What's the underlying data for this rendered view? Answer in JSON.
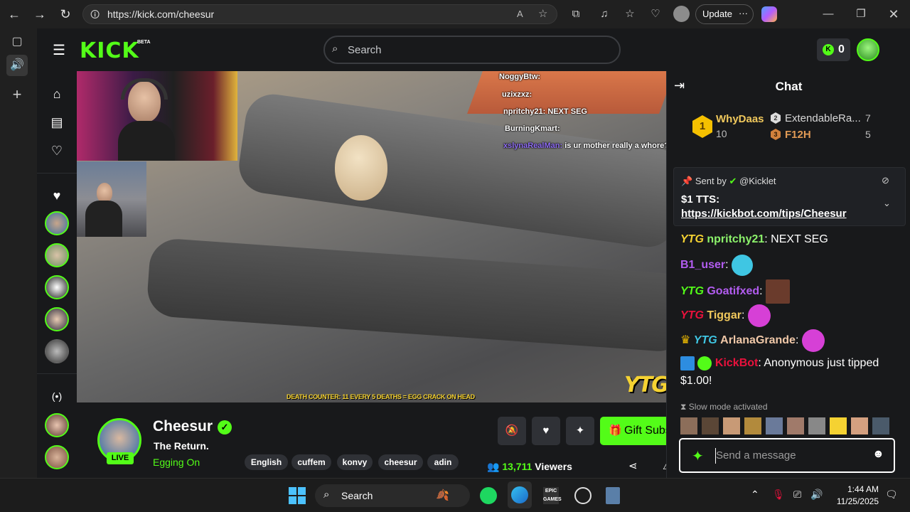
{
  "browser": {
    "url": "https://kick.com/cheesur",
    "update_label": "Update",
    "more_glyph": "···"
  },
  "site": {
    "logo": "KICK",
    "logo_badge": "BETA",
    "search_placeholder": "Search",
    "kicks_balance": "0",
    "accent_color": "#53fc18"
  },
  "stream": {
    "streamer_name": "Cheesur",
    "live_label": "LIVE",
    "title": "The Return.",
    "category": "Egging On",
    "tags": [
      "English",
      "cuffem",
      "konvy",
      "cheesur",
      "adin"
    ],
    "gift_subs_label": "Gift Subs",
    "viewer_count": "13,711",
    "viewers_label": "Viewers",
    "video_overlay": {
      "chat_lines": [
        {
          "name": "NoggyBtw:",
          "msg": ""
        },
        {
          "name": "uzixzxz:",
          "msg": ""
        },
        {
          "name": "npritchy21:",
          "msg": "NEXT SEG"
        },
        {
          "name": "BurningKmart:",
          "msg": ""
        },
        {
          "name": "xslynaRealMan:",
          "msg": "is ur mother really a whore?"
        }
      ],
      "watermark": "YTG",
      "counter_text": "DEATH COUNTER: 11     EVERY 5 DEATHS = EGG CRACK ON HEAD"
    }
  },
  "chat": {
    "title": "Chat",
    "top_gifters": [
      {
        "rank": "1",
        "name": "WhyDaas",
        "count": "10"
      },
      {
        "rank": "2",
        "name": "ExtendableRa...",
        "count": "7"
      },
      {
        "rank": "3",
        "name": "F12H",
        "count": "5"
      }
    ],
    "pinned": {
      "sent_by_label": "Sent by",
      "sender": "@Kicklet",
      "line1": "$1 TTS:",
      "line2": "https://kickbot.com/tips/Cheesur"
    },
    "messages": [
      {
        "badge": "YTG",
        "user": "npritchy21",
        "sep": ":",
        "text": "NEXT SEG",
        "color": "#8cf26b"
      },
      {
        "badge": "",
        "user": "B1_user",
        "sep": ":",
        "text": "",
        "color": "#b25cf0"
      },
      {
        "badge": "YTG",
        "user": "Goatifxed",
        "sep": ":",
        "text": "",
        "color": "#b25cf0"
      },
      {
        "badge": "YTG",
        "user": "Tiggar",
        "sep": ":",
        "text": "",
        "color": "#f0c85c"
      },
      {
        "badge": "YTG",
        "user": "ArlanaGrande",
        "sep": ":",
        "text": "",
        "color": "#f0c8a8"
      },
      {
        "badge": "",
        "user": "KickBot",
        "sep": ":",
        "text": "Anonymous just tipped",
        "text2": "$1.00!",
        "color": "#e9113c"
      }
    ],
    "slow_mode": "Slow mode activated",
    "input_placeholder": "Send a message"
  },
  "taskbar": {
    "search_placeholder": "Search",
    "time": "1:44 AM",
    "date": "11/25/2025"
  }
}
